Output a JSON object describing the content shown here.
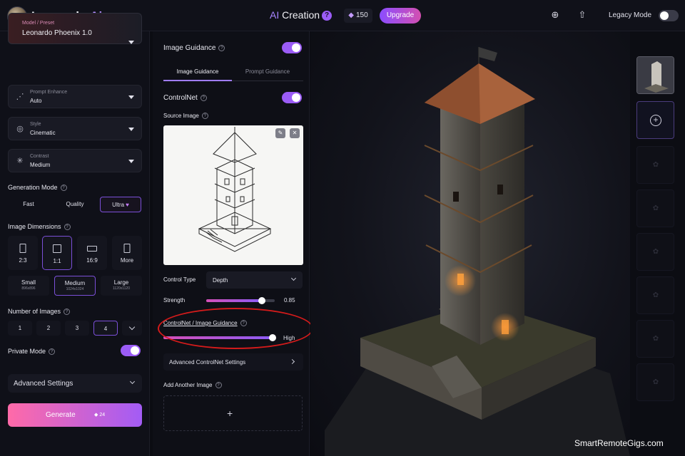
{
  "app": {
    "logo_name": "Leonardo",
    "logo_suffix": ".Ai",
    "title_prefix": "AI",
    "title_rest": " Creation",
    "help_glyph": "?",
    "token_count": "150",
    "upgrade_label": "Upgrade",
    "legacy_mode_label": "Legacy Mode"
  },
  "sidebar": {
    "preset": {
      "label": "Model / Preset",
      "value": "Leonardo Phoenix 1.0"
    },
    "prompt_enhance": {
      "label": "Prompt Enhance",
      "value": "Auto"
    },
    "style": {
      "label": "Style",
      "value": "Cinematic"
    },
    "contrast": {
      "label": "Contrast",
      "value": "Medium"
    },
    "generation_mode": {
      "label": "Generation Mode",
      "options": [
        "Fast",
        "Quality",
        "Ultra"
      ],
      "selected": "Ultra"
    },
    "image_dimensions": {
      "label": "Image Dimensions",
      "ratios": [
        "2:3",
        "1:1",
        "16:9",
        "More"
      ],
      "selected_ratio": "1:1",
      "sizes": [
        {
          "name": "Small",
          "dims": "896x896"
        },
        {
          "name": "Medium",
          "dims": "1024x1024"
        },
        {
          "name": "Large",
          "dims": "1120x1120"
        }
      ],
      "selected_size": "Medium"
    },
    "number_of_images": {
      "label": "Number of Images",
      "options": [
        "1",
        "2",
        "3",
        "4"
      ],
      "selected": "4"
    },
    "private_mode": {
      "label": "Private Mode",
      "enabled": true
    },
    "advanced_settings": "Advanced Settings",
    "generate": {
      "label": "Generate",
      "cost": "24"
    }
  },
  "guidance": {
    "title": "Image Guidance",
    "enabled": true,
    "tabs": [
      "Image Guidance",
      "Prompt Guidance"
    ],
    "active_tab": "Image Guidance",
    "controlnet": {
      "label": "ControlNet",
      "enabled": true
    },
    "source_image_label": "Source Image",
    "control_type": {
      "label": "Control Type",
      "value": "Depth"
    },
    "strength": {
      "label": "Strength",
      "value": "0.85"
    },
    "cn_ig_label": "ControlNet / Image Guidance",
    "cn_ig_value": "High",
    "advanced_controlnet": "Advanced ControlNet Settings",
    "add_another_image": "Add Another Image"
  },
  "watermark": "SmartRemoteGigs.com",
  "colors": {
    "accent": "#9b5cf6",
    "annotation_circle": "#d41b1b"
  }
}
